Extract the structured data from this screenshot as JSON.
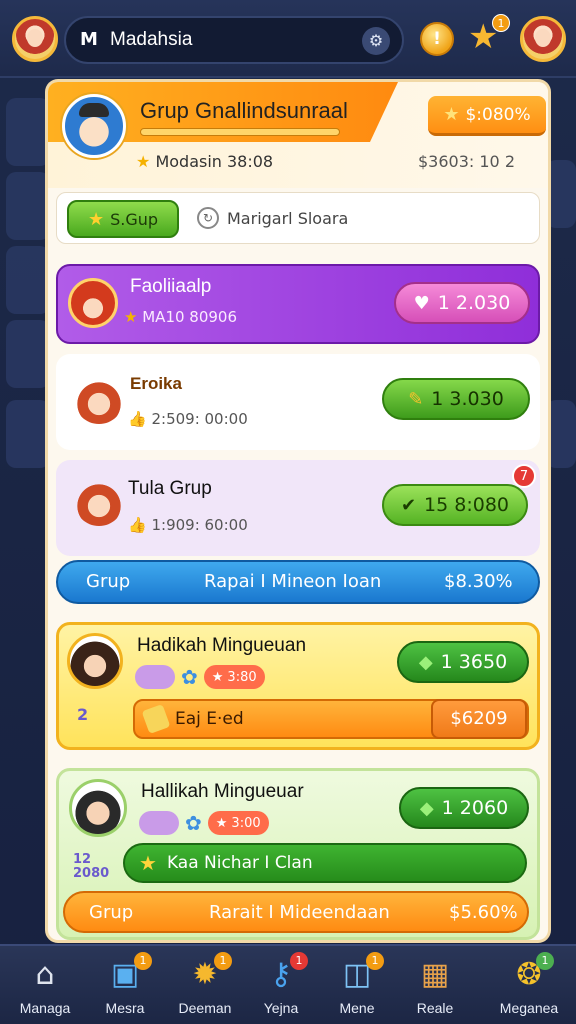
{
  "topbar": {
    "title": "Madahsia",
    "coin_label": "!",
    "star_badge": "1"
  },
  "header": {
    "title": "Grup Gnallindsunraal",
    "price": "$:080%",
    "subtitle": "Modasin 38:08",
    "right_value": "$3603: 10 2"
  },
  "tabs": [
    {
      "label": "S.Gup",
      "active": true
    },
    {
      "label": "Marigarl Sloara",
      "active": false
    }
  ],
  "rows": {
    "purple": {
      "title": "Faoliiaalp",
      "sub": "MA10 80906",
      "price": "1 2.030"
    },
    "white1": {
      "title": "Eroika",
      "sub": "2:509: 00:00",
      "price": "1 3.030"
    },
    "lilac": {
      "title": "Tula Grup",
      "sub": "1:909: 60:00",
      "price": "15 8:080",
      "badge": "7"
    },
    "blue": {
      "left": "Grup",
      "mid": "Rapai I Mineon Ioan",
      "right": "$8.30%"
    },
    "yellow": {
      "title": "Hadikah Mingueuan",
      "chip": "3:80",
      "price": "1 3650",
      "bar": "Eaj E·ed",
      "bar_price": "$6209",
      "deco": "2"
    },
    "green": {
      "title": "Hallikah Mingueuar",
      "chip": "3:00",
      "price": "1 2060",
      "bar": "Kaa Nichar I Clan",
      "bottom_left": "Grup",
      "bottom_mid": "Rarait I Mideendaan",
      "bottom_right": "$5.60%",
      "deco": "12 2080"
    }
  },
  "nav": [
    {
      "label": "Managa",
      "icon": "house-icon",
      "badge": ""
    },
    {
      "label": "Mesra",
      "icon": "chest-icon",
      "badge": "1"
    },
    {
      "label": "Deeman",
      "icon": "gear-icon",
      "badge": "1"
    },
    {
      "label": "Yejna",
      "icon": "key-icon",
      "badge": "1"
    },
    {
      "label": "Mene",
      "icon": "box-icon",
      "badge": "1"
    },
    {
      "label": "Reale",
      "icon": "treasure-icon",
      "badge": ""
    },
    {
      "label": "Meganea",
      "icon": "coin-bag-icon",
      "badge": "1"
    }
  ]
}
